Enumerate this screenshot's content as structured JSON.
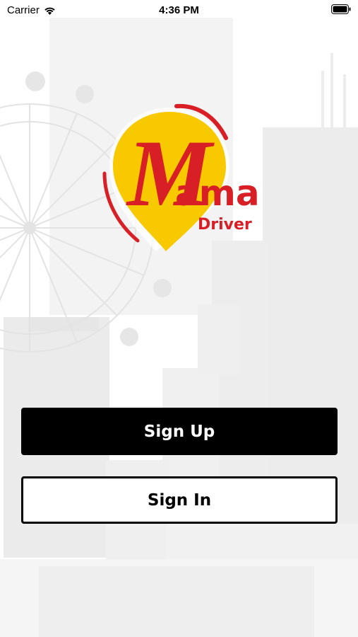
{
  "status_bar": {
    "carrier": "Carrier",
    "time": "4:36 PM",
    "wifi_icon": "wifi-icon",
    "battery_icon": "battery-icon"
  },
  "logo": {
    "letter": "M",
    "word": "ama",
    "subtitle": "Driver",
    "pin_color": "#F9C900",
    "text_color": "#D91F26"
  },
  "buttons": {
    "sign_up": "Sign Up",
    "sign_in": "Sign In"
  },
  "colors": {
    "primary_button_bg": "#000000",
    "secondary_button_bg": "#FFFFFF"
  }
}
